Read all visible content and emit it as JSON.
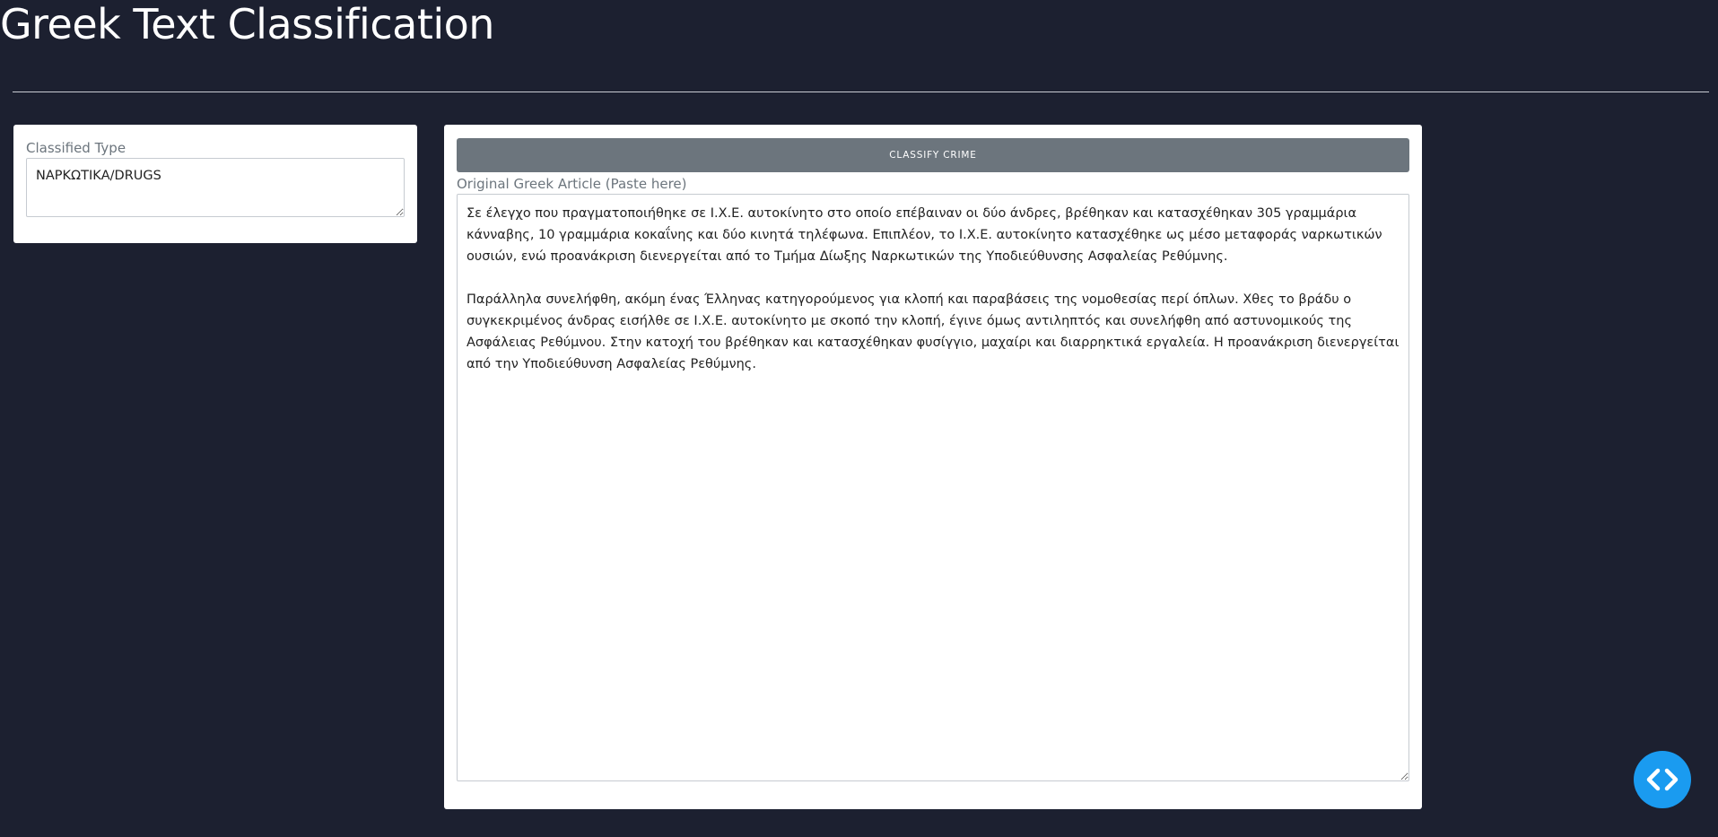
{
  "header": {
    "title": "Greek Text Classification"
  },
  "result_panel": {
    "label": "Classified Type",
    "value": "ΝΑΡΚΩΤΙΚΑ/DRUGS"
  },
  "input_panel": {
    "button_label": "CLASSIFY CRIME",
    "label": "Original Greek Article (Paste here)",
    "value": "Σε έλεγχο που πραγματοποιήθηκε σε Ι.Χ.Ε. αυτοκίνητο στο οποίο επέβαιναν οι δύο άνδρες, βρέθηκαν και κατασχέθηκαν 305 γραμμάρια κάνναβης, 10 γραμμάρια κοκαΐνης και δύο κινητά τηλέφωνα. Επιπλέον, το Ι.Χ.Ε. αυτοκίνητο κατασχέθηκε ως μέσο μεταφοράς ναρκωτικών ουσιών, ενώ προανάκριση διενεργείται από το Τμήμα Δίωξης Ναρκωτικών της Υποδιεύθυνσης Ασφαλείας Ρεθύμνης.\n\nΠαράλληλα συνελήφθη, ακόμη ένας Έλληνας κατηγορούμενος για κλοπή και παραβάσεις της νομοθεσίας περί όπλων. Χθες το βράδυ ο συγκεκριμένος άνδρας εισήλθε σε Ι.Χ.Ε. αυτοκίνητο με σκοπό την κλοπή, έγινε όμως αντιληπτός και συνελήφθη από αστυνομικούς της Ασφάλειας Ρεθύμνου. Στην κατοχή του βρέθηκαν και κατασχέθηκαν φυσίγγιο, μαχαίρι και διαρρηκτικά εργαλεία. Η προανάκριση διενεργείται από την Υποδιεύθυνση Ασφαλείας Ρεθύμνης."
  },
  "fab": {
    "icon": "code-icon"
  },
  "colors": {
    "background": "#1c2030",
    "button": "#6c757d",
    "fab": "#1a9bf0"
  }
}
